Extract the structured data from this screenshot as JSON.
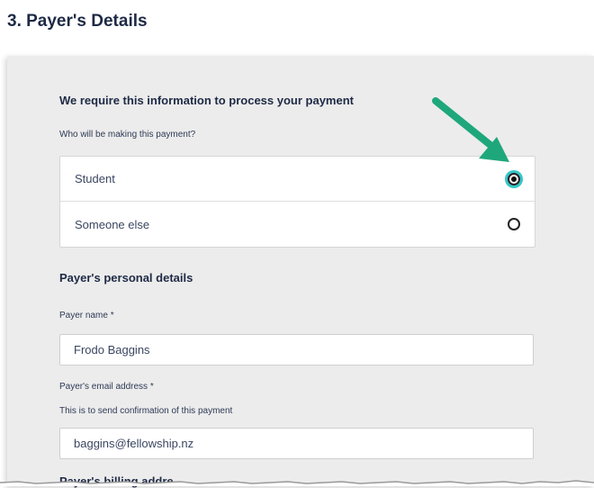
{
  "page_title": "3. Payer's Details",
  "intro_heading": "We require this information to process your payment",
  "payment_question": "Who will be making this payment?",
  "payer_options": [
    {
      "label": "Student",
      "selected": true
    },
    {
      "label": "Someone else",
      "selected": false
    }
  ],
  "personal_details_heading": "Payer's personal details",
  "payer_name": {
    "label": "Payer name *",
    "value": "Frodo Baggins"
  },
  "payer_email": {
    "label": "Payer's email address *",
    "hint": "This is to send confirmation of this payment",
    "value": "baggins@fellowship.nz"
  },
  "billing_heading": "Payer's billing addre",
  "colors": {
    "accent": "#33c6c9",
    "arrow": "#1fa77c",
    "heading": "#1e2a45",
    "panel": "#ececec"
  }
}
